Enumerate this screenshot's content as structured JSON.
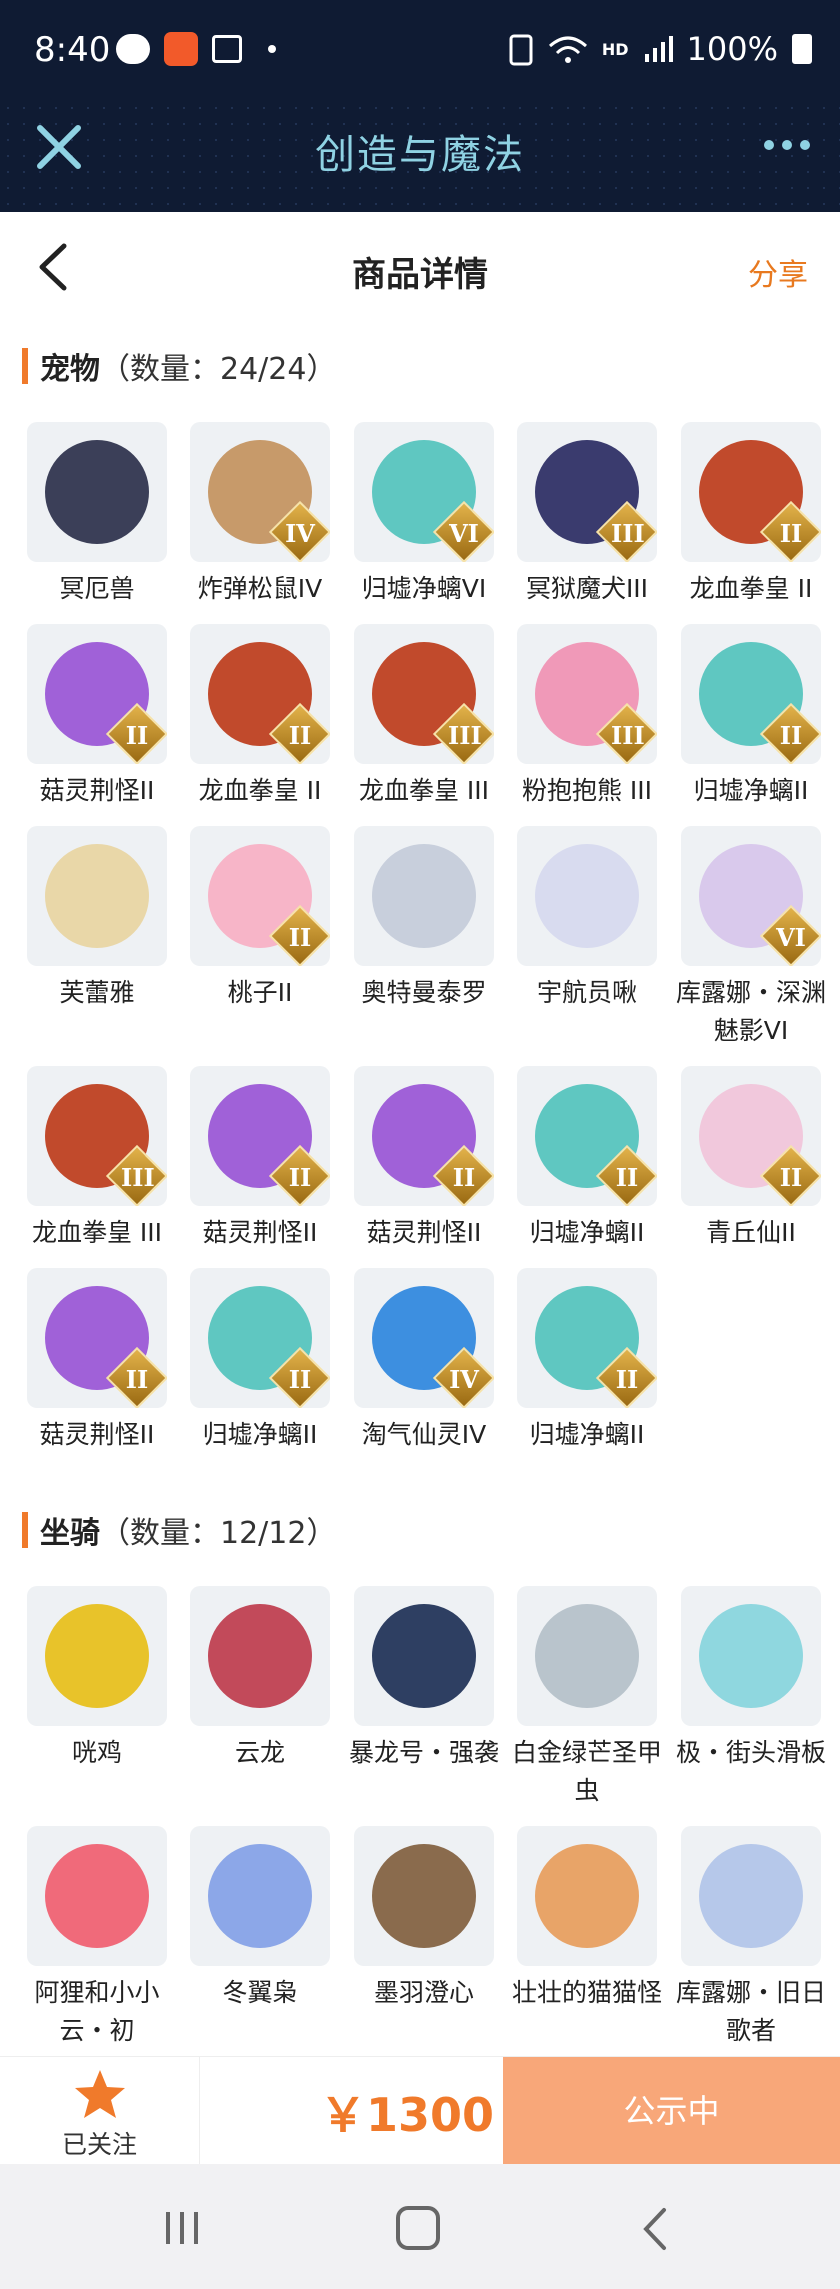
{
  "status_bar": {
    "time": "8:40",
    "hd_label": "HD",
    "battery_text": "100%"
  },
  "app_bar": {
    "title": "创造与魔法"
  },
  "nav": {
    "title": "商品详情",
    "share_label": "分享"
  },
  "pets": {
    "title": "宠物",
    "count": "（数量：24/24）",
    "items": [
      {
        "name": "冥厄兽",
        "badge": "",
        "color": "#3b3f58"
      },
      {
        "name": "炸弹松鼠IV",
        "badge": "IV",
        "color": "#c79a6a"
      },
      {
        "name": "归墟净螭VI",
        "badge": "VI",
        "color": "#5fc7c1"
      },
      {
        "name": "冥狱魔犬III",
        "badge": "III",
        "color": "#3a3b6e"
      },
      {
        "name": "龙血拳皇 II",
        "badge": "II",
        "color": "#c14a2c"
      },
      {
        "name": "菇灵荆怪II",
        "badge": "II",
        "color": "#a061d8"
      },
      {
        "name": "龙血拳皇 II",
        "badge": "II",
        "color": "#c14a2c"
      },
      {
        "name": "龙血拳皇 III",
        "badge": "III",
        "color": "#c14a2c"
      },
      {
        "name": "粉抱抱熊 III",
        "badge": "III",
        "color": "#f099b8"
      },
      {
        "name": "归墟净螭II",
        "badge": "II",
        "color": "#5fc7c1"
      },
      {
        "name": "芙蕾雅",
        "badge": "",
        "color": "#e9d7a8"
      },
      {
        "name": "桃子II",
        "badge": "II",
        "color": "#f7b5c8"
      },
      {
        "name": "奥特曼泰罗",
        "badge": "",
        "color": "#c8cfdc"
      },
      {
        "name": "宇航员啾",
        "badge": "",
        "color": "#d8dbef"
      },
      {
        "name": "库露娜・深渊魅影VI",
        "badge": "VI",
        "color": "#d9c9ec"
      },
      {
        "name": "龙血拳皇 III",
        "badge": "III",
        "color": "#c14a2c"
      },
      {
        "name": "菇灵荆怪II",
        "badge": "II",
        "color": "#a061d8"
      },
      {
        "name": "菇灵荆怪II",
        "badge": "II",
        "color": "#a061d8"
      },
      {
        "name": "归墟净螭II",
        "badge": "II",
        "color": "#5fc7c1"
      },
      {
        "name": "青丘仙II",
        "badge": "II",
        "color": "#f1c8dc"
      },
      {
        "name": "菇灵荆怪II",
        "badge": "II",
        "color": "#a061d8"
      },
      {
        "name": "归墟净螭II",
        "badge": "II",
        "color": "#5fc7c1"
      },
      {
        "name": "淘气仙灵IV",
        "badge": "IV",
        "color": "#3d8fe0"
      },
      {
        "name": "归墟净螭II",
        "badge": "II",
        "color": "#5fc7c1"
      }
    ]
  },
  "mounts": {
    "title": "坐骑",
    "count": "（数量：12/12）",
    "items": [
      {
        "name": "咣鸡",
        "badge": "",
        "color": "#e8c32a"
      },
      {
        "name": "云龙",
        "badge": "",
        "color": "#c24a5a"
      },
      {
        "name": "暴龙号・强袭",
        "badge": "",
        "color": "#2e3f62"
      },
      {
        "name": "白金绿芒圣甲虫",
        "badge": "",
        "color": "#b9c4cc"
      },
      {
        "name": "极・街头滑板",
        "badge": "",
        "color": "#8fd7df"
      },
      {
        "name": "阿狸和小小云・初",
        "badge": "",
        "color": "#f06a7a"
      },
      {
        "name": "冬翼枭",
        "badge": "",
        "color": "#8ca7e8"
      },
      {
        "name": "墨羽澄心",
        "badge": "",
        "color": "#8a6b4d"
      },
      {
        "name": "壮壮的猫猫怪",
        "badge": "",
        "color": "#e8a468"
      },
      {
        "name": "库露娜・旧日歌者",
        "badge": "",
        "color": "#b6c8ea"
      }
    ]
  },
  "bottom": {
    "follow_label": "已关注",
    "price": "￥1300",
    "status_label": "公示中"
  },
  "colors": {
    "accent": "#f07a2b",
    "header_bg": "#0f1b33",
    "title_color": "#8fd2e3"
  }
}
